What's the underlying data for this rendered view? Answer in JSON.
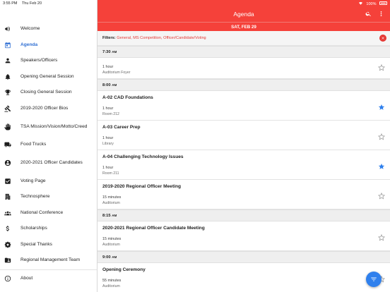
{
  "status_bar": {
    "time": "3:55 PM",
    "date": "Thu Feb 20",
    "battery": "100%"
  },
  "sidebar": {
    "items": [
      {
        "label": "Welcome",
        "icon": "megaphone-icon"
      },
      {
        "label": "Agenda",
        "icon": "calendar-icon",
        "active": true
      },
      {
        "label": "Speakers/Officers",
        "icon": "person-icon"
      },
      {
        "label": "Opening General Session",
        "icon": "bell-icon"
      },
      {
        "label": "Closing General Session",
        "icon": "trophy-icon"
      },
      {
        "label": "2019-2020 Officer Bios",
        "icon": "gavel-icon"
      },
      {
        "label": "TSA Mission/Vision/Motto/Creed",
        "icon": "hand-icon"
      },
      {
        "label": "Food Trucks",
        "icon": "truck-icon"
      },
      {
        "label": "2020-2021 Officer Candidates",
        "icon": "account-circle-icon"
      },
      {
        "label": "Voting Page",
        "icon": "checkbox-icon"
      },
      {
        "label": "Technosphere",
        "icon": "building-icon"
      },
      {
        "label": "National Conference",
        "icon": "group-icon"
      },
      {
        "label": "Scholarships",
        "icon": "dollar-icon"
      },
      {
        "label": "Special Thanks",
        "icon": "badge-star-icon"
      },
      {
        "label": "Regional Management Team",
        "icon": "folder-person-icon"
      },
      {
        "label": "About",
        "icon": "info-icon"
      }
    ]
  },
  "header": {
    "title": "Agenda",
    "date": "SAT, FEB 29"
  },
  "filter": {
    "label": "Filters:",
    "values": "General, MS Competition, Officer/Candidate/Voting"
  },
  "agenda": {
    "groups": [
      {
        "time": "7:30",
        "ampm": "AM",
        "sessions": [
          {
            "title": "",
            "duration": "1 hour",
            "room": "Auditorium Foyer",
            "starred": false
          }
        ]
      },
      {
        "time": "8:00",
        "ampm": "AM",
        "sessions": [
          {
            "title": "A-02 CAD Foundations",
            "duration": "1 hour",
            "room": "Room 212",
            "starred": true
          },
          {
            "title": "A-03 Career Prep",
            "duration": "1 hour",
            "room": "Library",
            "starred": false
          },
          {
            "title": "A-04 Challenging Technology Issues",
            "duration": "1 hour",
            "room": "Room 211",
            "starred": true
          },
          {
            "title": "2019-2020 Regional Officer Meeting",
            "duration": "15 minutes",
            "room": "Auditorium",
            "starred": false
          }
        ]
      },
      {
        "time": "8:15",
        "ampm": "AM",
        "sessions": [
          {
            "title": "2020-2021 Regional Officer Candidate Meeting",
            "duration": "15 minutes",
            "room": "Auditorium",
            "starred": false
          }
        ]
      },
      {
        "time": "9:00",
        "ampm": "AM",
        "sessions": [
          {
            "title": "Opening Ceremony",
            "duration": "55 minutes",
            "room": "Auditorium",
            "starred": false
          }
        ]
      }
    ]
  },
  "colors": {
    "brand": "#f5413a",
    "accent": "#2f6fd3",
    "star_active": "#2f80ed",
    "star_inactive": "#9a9a9a"
  }
}
